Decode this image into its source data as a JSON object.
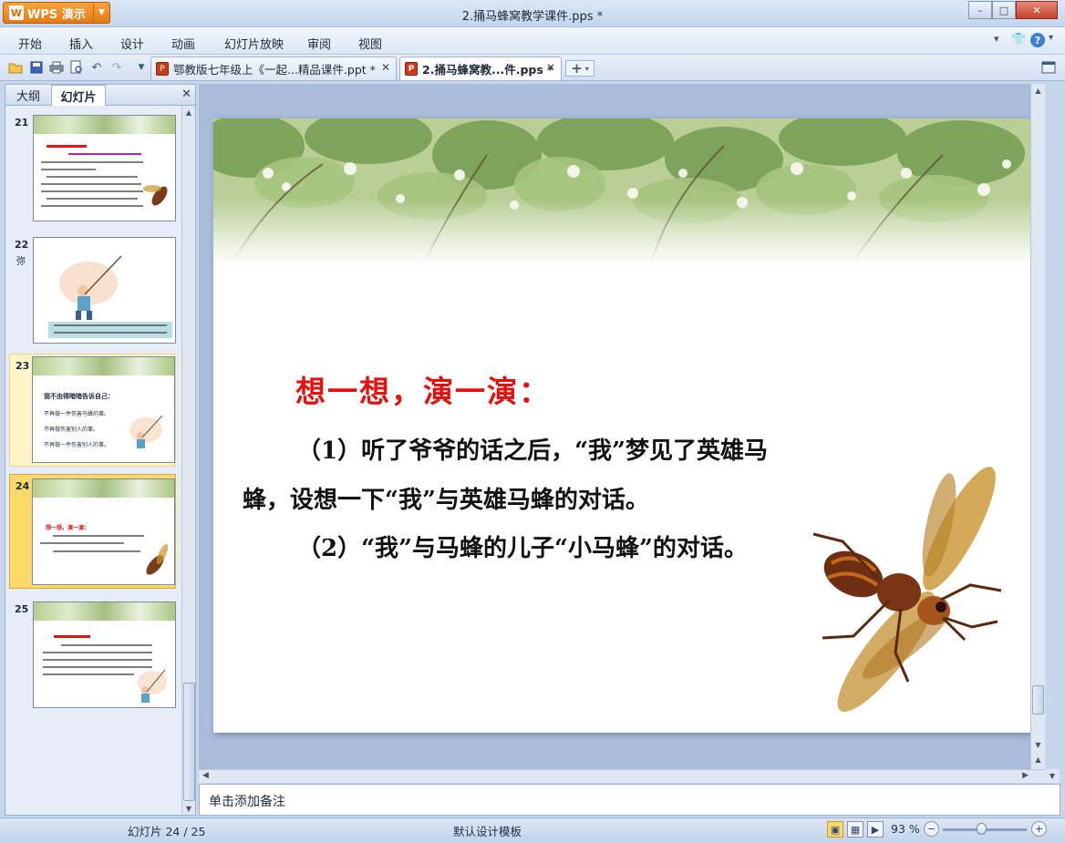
{
  "app": {
    "button_label": "WPS 演示",
    "logo_letter": "W",
    "window_title": "2.捅马蜂窝教学课件.pps *"
  },
  "window_controls": {
    "minimize": "–",
    "maximize": "□",
    "close": "✕"
  },
  "menu": {
    "items": [
      "开始",
      "插入",
      "设计",
      "动画",
      "幻灯片放映",
      "审阅",
      "视图"
    ]
  },
  "toolbar": {
    "doc_tabs": [
      {
        "label": "鄂教版七年级上《一起...精品课件.ppt *",
        "active": false,
        "close": "✕"
      },
      {
        "label": "2.捅马蜂窝教...件.pps *",
        "active": true,
        "close": "✕"
      }
    ],
    "new_tab": "+"
  },
  "left_panel": {
    "tabs": [
      "大纲",
      "幻灯片"
    ],
    "active_tab": "幻灯片",
    "close": "✕",
    "slides": [
      {
        "number": "21",
        "note": ""
      },
      {
        "number": "22",
        "note": "弥"
      },
      {
        "number": "23",
        "note": ""
      },
      {
        "number": "24",
        "note": ""
      },
      {
        "number": "25",
        "note": ""
      }
    ],
    "selected_slide": "24",
    "thumb23_lines": [
      "我不由得暗暗告诉自己：",
      "不再做一件伤害马蜂的事。",
      "不再做伤害别人的事。",
      "不再做一件伤害别人的事。"
    ],
    "thumb24_title": "想一想，演一演："
  },
  "slide": {
    "title": "想一想，演一演：",
    "line1": "（1）听了爷爷的话之后，“我”梦见了英雄马",
    "line2": "蜂，设想一下“我”与英雄马蜂的对话。",
    "line3": "（2）“我”与马蜂的儿子“小马蜂”的对话。"
  },
  "notes_placeholder": "单击添加备注",
  "status": {
    "slide_counter": "幻灯片 24 / 25",
    "template": "默认设计模板",
    "zoom": "93 %",
    "zoom_level": 0.93,
    "zoom_minus": "−",
    "zoom_plus": "+"
  },
  "colors": {
    "title_red": "#e41111",
    "accent_orange": "#e57a12",
    "selected_thumb": "#fbd96a"
  }
}
